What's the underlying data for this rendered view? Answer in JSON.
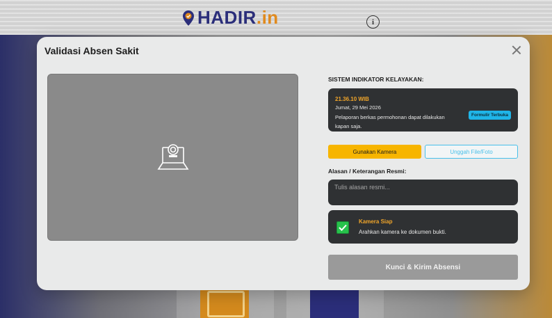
{
  "app": {
    "brand_name": "HADIR",
    "brand_tld": ".in",
    "info_icon": "info-icon"
  },
  "modal": {
    "title": "Validasi Absen Sakit",
    "close_icon": "close-icon",
    "camera_placeholder_icon": "laptop-camera-icon",
    "indikator_label": "SISTEM INDIKATOR KELAYAKAN:",
    "status": {
      "time": "21.36.10 WIB",
      "date": "Jumat, 29 Mei 2026",
      "description": "Pelaporan berkas permohonan dapat dilakukan kapan saja.",
      "badge": "Formulir Terbuka"
    },
    "buttons": {
      "camera": "Gunakan Kamera",
      "upload": "Unggah File/Foto",
      "submit": "Kunci & Kirim Absensi"
    },
    "reason": {
      "label": "Alasan / Keterangan Resmi:",
      "placeholder": "Tulis alasan resmi...",
      "value": ""
    },
    "camera_status": {
      "title": "Kamera Siap",
      "text": "Arahkan kamera ke dokumen bukti.",
      "checked": true
    }
  },
  "colors": {
    "accent_orange": "#f0a52a",
    "accent_yellow": "#f7b500",
    "accent_cyan": "#47c0ea",
    "success_green": "#27c24c",
    "brand_navy": "#2b2e7a"
  }
}
